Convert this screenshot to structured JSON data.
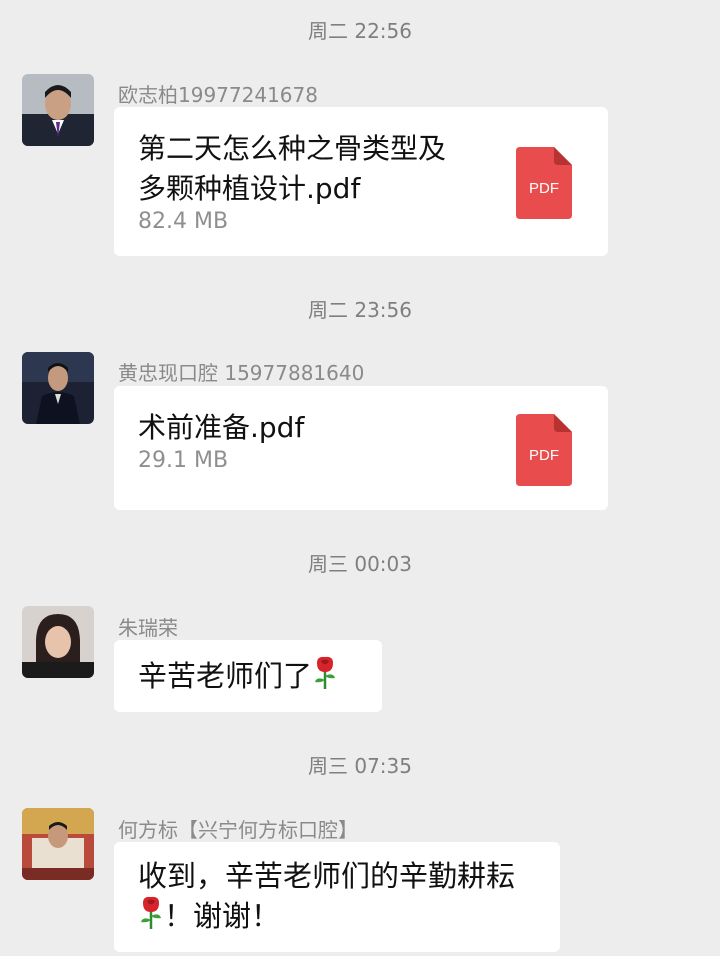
{
  "chat": {
    "messages": [
      {
        "time": "周二 22:56",
        "sender": "欧志柏19977241678",
        "file_name_line1": "第二天怎么种之骨类型及",
        "file_name_line2": "多颗种植设计.pdf",
        "file_size": "82.4 MB",
        "file_badge": "PDF"
      },
      {
        "time": "周二 23:56",
        "sender": "黄忠现口腔 15977881640",
        "file_name_line1": "术前准备.pdf",
        "file_size": "29.1 MB",
        "file_badge": "PDF"
      },
      {
        "time": "周三 00:03",
        "sender": "朱瑞荣",
        "text": "辛苦老师们了"
      },
      {
        "time": "周三 07:35",
        "sender": "何方标【兴宁何方标口腔】",
        "text_line1": "收到，辛苦老师们的辛勤耕耘",
        "text_line2": "！谢谢！"
      }
    ]
  },
  "icons": {
    "file": "pdf-file-icon",
    "emoji": "rose-emoji-icon"
  },
  "colors": {
    "background": "#ededed",
    "bubble": "#ffffff",
    "pdf_red": "#e84c4c",
    "meta_text": "#8a8a8a"
  }
}
